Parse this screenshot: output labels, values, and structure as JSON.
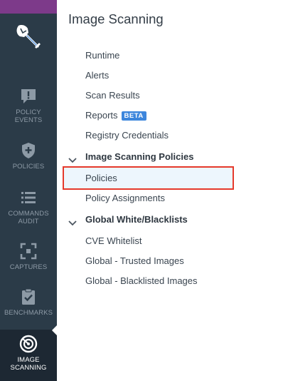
{
  "page_title": "Image Scanning",
  "sidebar": {
    "logo_icon": "shovel-logo-icon",
    "items": [
      {
        "label": "POLICY\nEVENTS",
        "icon": "alert-bubble-icon"
      },
      {
        "label": "POLICIES",
        "icon": "shield-plus-icon"
      },
      {
        "label": "COMMANDS\nAUDIT",
        "icon": "list-icon"
      },
      {
        "label": "CAPTURES",
        "icon": "capture-frame-icon"
      },
      {
        "label": "BENCHMARKS",
        "icon": "clipboard-check-icon"
      },
      {
        "label": "IMAGE\nSCANNING",
        "icon": "radar-target-icon",
        "active": true
      }
    ]
  },
  "menu": {
    "runtime": "Runtime",
    "alerts": "Alerts",
    "scan_results": "Scan Results",
    "reports": "Reports",
    "reports_badge": "BETA",
    "registry_credentials": "Registry Credentials",
    "group_policies": "Image Scanning Policies",
    "policies": "Policies",
    "policy_assignments": "Policy Assignments",
    "group_whitelists": "Global White/Blacklists",
    "cve_whitelist": "CVE Whitelist",
    "trusted_images": "Global - Trusted Images",
    "blacklisted_images": "Global - Blacklisted Images"
  },
  "colors": {
    "rail_bg": "#2b3b48",
    "rail_top_accent": "#7d3a8a",
    "badge_blue": "#3d86dc",
    "highlight_border": "#e53a2c",
    "selected_bg": "#edf6fd"
  }
}
